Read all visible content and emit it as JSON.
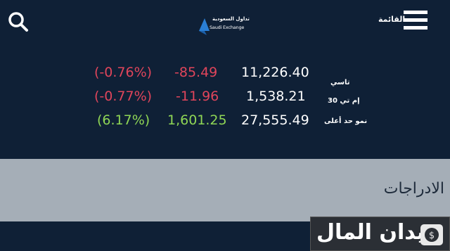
{
  "header": {
    "menu_label": "القائمة",
    "logo_ar": "تداول السعودية",
    "logo_en": "Saudi Exchange",
    "brand_color": "#2a7fd6"
  },
  "market": {
    "rows": [
      {
        "name": "تاسي",
        "value": "11,226.40",
        "change": "-85.49",
        "change_pct": "(-0.76%)",
        "status": "negative"
      },
      {
        "name": "إم تي 30",
        "value": "1,538.21",
        "change": "-11.96",
        "change_pct": "(-0.77%)",
        "status": "negative"
      },
      {
        "name": "نمو حد أعلى",
        "value": "27,555.49",
        "change": "1,601.25",
        "change_pct": "(6.17%)",
        "status": "positive"
      }
    ],
    "colors": {
      "negative": "#e0455b",
      "positive": "#8fd655"
    }
  },
  "section": {
    "title": "الادراجات"
  },
  "watermark": {
    "text": "ميدان المال"
  }
}
